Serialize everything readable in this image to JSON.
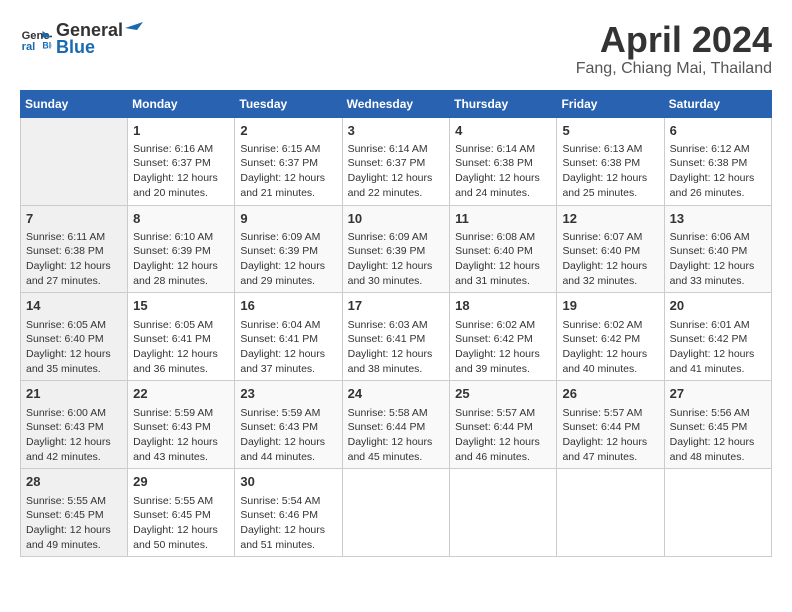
{
  "logo": {
    "line1": "General",
    "line2": "Blue"
  },
  "title": "April 2024",
  "location": "Fang, Chiang Mai, Thailand",
  "days_of_week": [
    "Sunday",
    "Monday",
    "Tuesday",
    "Wednesday",
    "Thursday",
    "Friday",
    "Saturday"
  ],
  "weeks": [
    [
      {
        "day": "",
        "info": ""
      },
      {
        "day": "1",
        "info": "Sunrise: 6:16 AM\nSunset: 6:37 PM\nDaylight: 12 hours\nand 20 minutes."
      },
      {
        "day": "2",
        "info": "Sunrise: 6:15 AM\nSunset: 6:37 PM\nDaylight: 12 hours\nand 21 minutes."
      },
      {
        "day": "3",
        "info": "Sunrise: 6:14 AM\nSunset: 6:37 PM\nDaylight: 12 hours\nand 22 minutes."
      },
      {
        "day": "4",
        "info": "Sunrise: 6:14 AM\nSunset: 6:38 PM\nDaylight: 12 hours\nand 24 minutes."
      },
      {
        "day": "5",
        "info": "Sunrise: 6:13 AM\nSunset: 6:38 PM\nDaylight: 12 hours\nand 25 minutes."
      },
      {
        "day": "6",
        "info": "Sunrise: 6:12 AM\nSunset: 6:38 PM\nDaylight: 12 hours\nand 26 minutes."
      }
    ],
    [
      {
        "day": "7",
        "info": "Sunrise: 6:11 AM\nSunset: 6:38 PM\nDaylight: 12 hours\nand 27 minutes."
      },
      {
        "day": "8",
        "info": "Sunrise: 6:10 AM\nSunset: 6:39 PM\nDaylight: 12 hours\nand 28 minutes."
      },
      {
        "day": "9",
        "info": "Sunrise: 6:09 AM\nSunset: 6:39 PM\nDaylight: 12 hours\nand 29 minutes."
      },
      {
        "day": "10",
        "info": "Sunrise: 6:09 AM\nSunset: 6:39 PM\nDaylight: 12 hours\nand 30 minutes."
      },
      {
        "day": "11",
        "info": "Sunrise: 6:08 AM\nSunset: 6:40 PM\nDaylight: 12 hours\nand 31 minutes."
      },
      {
        "day": "12",
        "info": "Sunrise: 6:07 AM\nSunset: 6:40 PM\nDaylight: 12 hours\nand 32 minutes."
      },
      {
        "day": "13",
        "info": "Sunrise: 6:06 AM\nSunset: 6:40 PM\nDaylight: 12 hours\nand 33 minutes."
      }
    ],
    [
      {
        "day": "14",
        "info": "Sunrise: 6:05 AM\nSunset: 6:40 PM\nDaylight: 12 hours\nand 35 minutes."
      },
      {
        "day": "15",
        "info": "Sunrise: 6:05 AM\nSunset: 6:41 PM\nDaylight: 12 hours\nand 36 minutes."
      },
      {
        "day": "16",
        "info": "Sunrise: 6:04 AM\nSunset: 6:41 PM\nDaylight: 12 hours\nand 37 minutes."
      },
      {
        "day": "17",
        "info": "Sunrise: 6:03 AM\nSunset: 6:41 PM\nDaylight: 12 hours\nand 38 minutes."
      },
      {
        "day": "18",
        "info": "Sunrise: 6:02 AM\nSunset: 6:42 PM\nDaylight: 12 hours\nand 39 minutes."
      },
      {
        "day": "19",
        "info": "Sunrise: 6:02 AM\nSunset: 6:42 PM\nDaylight: 12 hours\nand 40 minutes."
      },
      {
        "day": "20",
        "info": "Sunrise: 6:01 AM\nSunset: 6:42 PM\nDaylight: 12 hours\nand 41 minutes."
      }
    ],
    [
      {
        "day": "21",
        "info": "Sunrise: 6:00 AM\nSunset: 6:43 PM\nDaylight: 12 hours\nand 42 minutes."
      },
      {
        "day": "22",
        "info": "Sunrise: 5:59 AM\nSunset: 6:43 PM\nDaylight: 12 hours\nand 43 minutes."
      },
      {
        "day": "23",
        "info": "Sunrise: 5:59 AM\nSunset: 6:43 PM\nDaylight: 12 hours\nand 44 minutes."
      },
      {
        "day": "24",
        "info": "Sunrise: 5:58 AM\nSunset: 6:44 PM\nDaylight: 12 hours\nand 45 minutes."
      },
      {
        "day": "25",
        "info": "Sunrise: 5:57 AM\nSunset: 6:44 PM\nDaylight: 12 hours\nand 46 minutes."
      },
      {
        "day": "26",
        "info": "Sunrise: 5:57 AM\nSunset: 6:44 PM\nDaylight: 12 hours\nand 47 minutes."
      },
      {
        "day": "27",
        "info": "Sunrise: 5:56 AM\nSunset: 6:45 PM\nDaylight: 12 hours\nand 48 minutes."
      }
    ],
    [
      {
        "day": "28",
        "info": "Sunrise: 5:55 AM\nSunset: 6:45 PM\nDaylight: 12 hours\nand 49 minutes."
      },
      {
        "day": "29",
        "info": "Sunrise: 5:55 AM\nSunset: 6:45 PM\nDaylight: 12 hours\nand 50 minutes."
      },
      {
        "day": "30",
        "info": "Sunrise: 5:54 AM\nSunset: 6:46 PM\nDaylight: 12 hours\nand 51 minutes."
      },
      {
        "day": "",
        "info": ""
      },
      {
        "day": "",
        "info": ""
      },
      {
        "day": "",
        "info": ""
      },
      {
        "day": "",
        "info": ""
      }
    ]
  ]
}
